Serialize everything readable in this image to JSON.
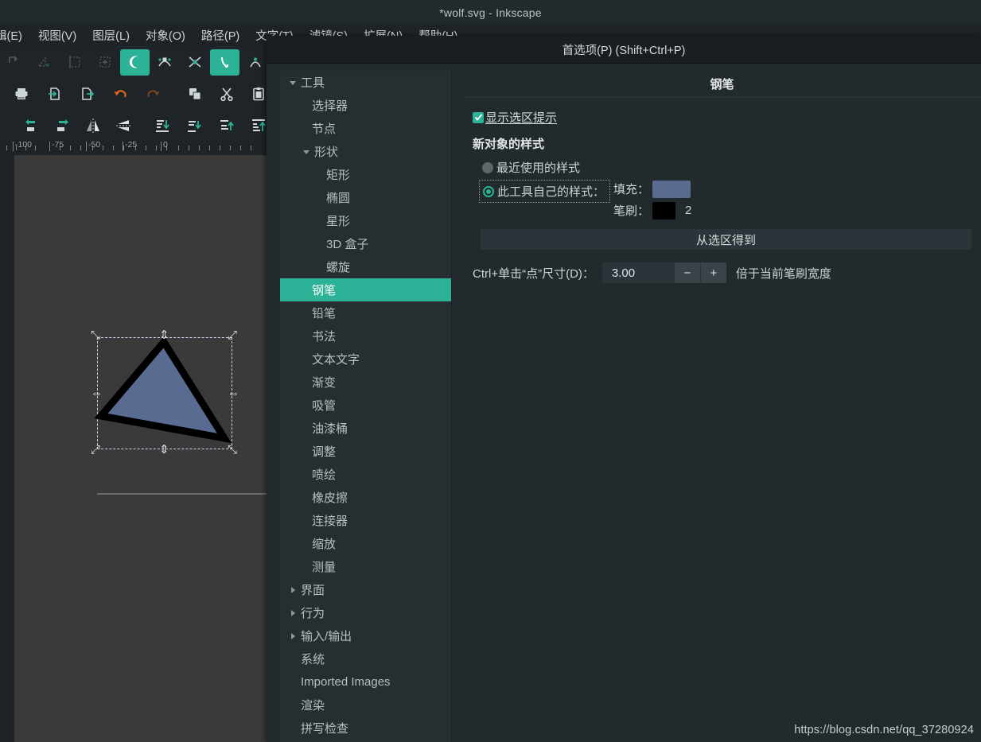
{
  "window": {
    "title": "*wolf.svg - Inkscape"
  },
  "menubar": {
    "items": [
      {
        "label": "辑(E)",
        "name": "menu-edit"
      },
      {
        "label": "视图(V)",
        "name": "menu-view"
      },
      {
        "label": "图层(L)",
        "name": "menu-layer"
      },
      {
        "label": "对象(O)",
        "name": "menu-object"
      },
      {
        "label": "路径(P)",
        "name": "menu-path"
      },
      {
        "label": "文字(T)",
        "name": "menu-text"
      },
      {
        "label": "滤镜(S)",
        "name": "menu-filters"
      },
      {
        "label": "扩展(N)",
        "name": "menu-extensions"
      },
      {
        "label": "帮助(H)",
        "name": "menu-help"
      }
    ]
  },
  "toolbars": {
    "snap_row": [
      {
        "name": "snap-node-icon",
        "state": "dim"
      },
      {
        "name": "snap-bbox-corner-icon",
        "state": "dim"
      },
      {
        "name": "snap-bbox-edge-midpoint-icon",
        "state": "dim"
      },
      {
        "name": "snap-bbox-center-icon",
        "state": "dim"
      },
      {
        "name": "snap-path-icon",
        "state": "active"
      },
      {
        "name": "snap-path-intersection-icon",
        "state": "normal"
      },
      {
        "name": "snap-cusp-node-icon",
        "state": "normal"
      },
      {
        "name": "snap-smooth-node-icon",
        "state": "active"
      },
      {
        "name": "snap-midpoint-icon",
        "state": "normal"
      }
    ],
    "commands_row": [
      {
        "name": "print-icon"
      },
      {
        "name": "import-icon"
      },
      {
        "name": "export-icon"
      },
      {
        "name": "undo-icon"
      },
      {
        "name": "redo-icon"
      },
      {
        "name": "duplicate-icon"
      },
      {
        "name": "cut-icon"
      },
      {
        "name": "paste-icon"
      }
    ],
    "align_row": [
      {
        "name": "rotate-left-icon"
      },
      {
        "name": "rotate-right-icon"
      },
      {
        "name": "flip-horizontal-icon"
      },
      {
        "name": "flip-vertical-icon"
      },
      {
        "name": "lower-to-bottom-icon"
      },
      {
        "name": "lower-icon"
      },
      {
        "name": "raise-icon"
      },
      {
        "name": "raise-to-top-icon"
      }
    ]
  },
  "ruler": {
    "labels": [
      "-100",
      "-75",
      "-50",
      "-25",
      "0"
    ]
  },
  "canvas": {
    "shape_name": "triangle-path",
    "fill": "#5a6b91",
    "stroke": "#000000"
  },
  "dialog": {
    "title": "首选项(P) (Shift+Ctrl+P)",
    "tree": [
      {
        "label": "工具",
        "level": 0,
        "arrow": "down",
        "selected": false,
        "name": "tree-item-tools"
      },
      {
        "label": "选择器",
        "level": 1,
        "arrow": "none",
        "selected": false,
        "name": "tree-item-selector"
      },
      {
        "label": "节点",
        "level": 1,
        "arrow": "none",
        "selected": false,
        "name": "tree-item-node"
      },
      {
        "label": "形状",
        "level": 1,
        "arrow": "down",
        "selected": false,
        "name": "tree-item-shapes"
      },
      {
        "label": "矩形",
        "level": 2,
        "arrow": "none",
        "selected": false,
        "name": "tree-item-rectangle"
      },
      {
        "label": "椭圆",
        "level": 2,
        "arrow": "none",
        "selected": false,
        "name": "tree-item-ellipse"
      },
      {
        "label": "星形",
        "level": 2,
        "arrow": "none",
        "selected": false,
        "name": "tree-item-star"
      },
      {
        "label": "3D 盒子",
        "level": 2,
        "arrow": "none",
        "selected": false,
        "name": "tree-item-3dbox"
      },
      {
        "label": "螺旋",
        "level": 2,
        "arrow": "none",
        "selected": false,
        "name": "tree-item-spiral"
      },
      {
        "label": "钢笔",
        "level": 1,
        "arrow": "none",
        "selected": true,
        "name": "tree-item-pen"
      },
      {
        "label": "铅笔",
        "level": 1,
        "arrow": "none",
        "selected": false,
        "name": "tree-item-pencil"
      },
      {
        "label": "书法",
        "level": 1,
        "arrow": "none",
        "selected": false,
        "name": "tree-item-calligraphy"
      },
      {
        "label": "文本文字",
        "level": 1,
        "arrow": "none",
        "selected": false,
        "name": "tree-item-text"
      },
      {
        "label": "渐变",
        "level": 1,
        "arrow": "none",
        "selected": false,
        "name": "tree-item-gradient"
      },
      {
        "label": "吸管",
        "level": 1,
        "arrow": "none",
        "selected": false,
        "name": "tree-item-dropper"
      },
      {
        "label": "油漆桶",
        "level": 1,
        "arrow": "none",
        "selected": false,
        "name": "tree-item-paintbucket"
      },
      {
        "label": "调整",
        "level": 1,
        "arrow": "none",
        "selected": false,
        "name": "tree-item-tweak"
      },
      {
        "label": "喷绘",
        "level": 1,
        "arrow": "none",
        "selected": false,
        "name": "tree-item-spray"
      },
      {
        "label": "橡皮擦",
        "level": 1,
        "arrow": "none",
        "selected": false,
        "name": "tree-item-eraser"
      },
      {
        "label": "连接器",
        "level": 1,
        "arrow": "none",
        "selected": false,
        "name": "tree-item-connector"
      },
      {
        "label": "缩放",
        "level": 1,
        "arrow": "none",
        "selected": false,
        "name": "tree-item-zoom"
      },
      {
        "label": "测量",
        "level": 1,
        "arrow": "none",
        "selected": false,
        "name": "tree-item-measure"
      },
      {
        "label": "界面",
        "level": 0,
        "arrow": "right",
        "selected": false,
        "name": "tree-item-interface"
      },
      {
        "label": "行为",
        "level": 0,
        "arrow": "right",
        "selected": false,
        "name": "tree-item-behavior"
      },
      {
        "label": "输入/输出",
        "level": 0,
        "arrow": "right",
        "selected": false,
        "name": "tree-item-input-output"
      },
      {
        "label": "系统",
        "level": 0,
        "arrow": "none",
        "selected": false,
        "name": "tree-item-system"
      },
      {
        "label": "Imported Images",
        "level": 0,
        "arrow": "none",
        "selected": false,
        "name": "tree-item-imported-images"
      },
      {
        "label": "渲染",
        "level": 0,
        "arrow": "none",
        "selected": false,
        "name": "tree-item-rendering"
      },
      {
        "label": "拼写检查",
        "level": 0,
        "arrow": "none",
        "selected": false,
        "name": "tree-item-spellcheck"
      }
    ],
    "pane": {
      "header": "钢笔",
      "show_selection_cue": {
        "label": "显示选区提示",
        "checked": true
      },
      "group_title": "新对象的样式",
      "radio_last_used": {
        "label": "最近使用的样式",
        "selected": false
      },
      "radio_own_style": {
        "label": "此工具自己的样式：",
        "selected": true
      },
      "fill_label": "填充：",
      "fill_color": "#5a6b91",
      "stroke_label": "笔刷：",
      "stroke_color": "#000000",
      "stroke_width": "2",
      "take_from_selection": "从选区得到",
      "dot_size_label": "Ctrl+单击“点”尺寸(D)：",
      "dot_size_value": "3.00",
      "spin_minus": "−",
      "spin_plus": "+",
      "dot_size_suffix": "倍于当前笔刷宽度"
    }
  },
  "watermark": "https://blog.csdn.net/qq_37280924",
  "colors": {
    "accent_teal": "#2cb397",
    "selection_blue": "#3b4fd8",
    "window_bg": "#232a2d",
    "canvas_bg": "#3a3a3a"
  }
}
